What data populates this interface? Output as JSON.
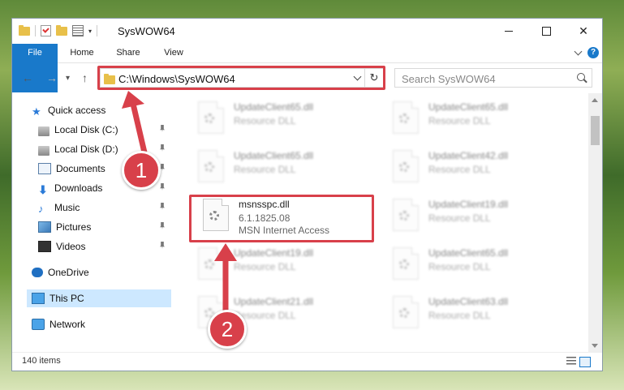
{
  "window": {
    "title": "SysWOW64",
    "controls": {
      "minimize_icon": "minimize-icon",
      "maximize_icon": "maximize-icon",
      "close_glyph": "✕"
    }
  },
  "ribbon": {
    "tabs": [
      "File",
      "Home",
      "Share",
      "View"
    ],
    "help_glyph": "?"
  },
  "nav": {
    "back_glyph": "←",
    "forward_glyph": "→",
    "recent_glyph": "▾",
    "up_glyph": "↑",
    "address_path": "C:\\Windows\\SysWOW64",
    "refresh_glyph": "↻",
    "search_placeholder": "Search SysWOW64"
  },
  "sidebar": {
    "quick_access": "Quick access",
    "items": [
      "Local Disk (C:)",
      "Local Disk (D:)",
      "Documents",
      "Downloads",
      "Music",
      "Pictures",
      "Videos"
    ],
    "onedrive": "OneDrive",
    "this_pc": "This PC",
    "network": "Network"
  },
  "files": {
    "highlighted": {
      "name": "msnsspc.dll",
      "version": "6.1.1825.08",
      "description": "MSN Internet Access"
    },
    "blurred": [
      {
        "name": "UpdateClient65.dll",
        "type": "Resource DLL"
      },
      {
        "name": "UpdateClient65.dll",
        "type": "Resource DLL"
      },
      {
        "name": "UpdateClient65.dll",
        "type": "Resource DLL"
      },
      {
        "name": "UpdateClient42.dll",
        "type": "Resource DLL"
      },
      {
        "name": "UpdateClient19.dll",
        "type": "Resource DLL"
      },
      {
        "name": "UpdateClient19.dll",
        "type": "Resource DLL"
      },
      {
        "name": "UpdateClient65.dll",
        "type": "Resource DLL"
      },
      {
        "name": "UpdateClient21.dll",
        "type": "Resource DLL"
      },
      {
        "name": "UpdateClient63.dll",
        "type": "Resource DLL"
      }
    ]
  },
  "status": {
    "item_count": "140 items"
  },
  "annotations": {
    "step1": "1",
    "step2": "2",
    "accent_color": "#d8404a"
  }
}
